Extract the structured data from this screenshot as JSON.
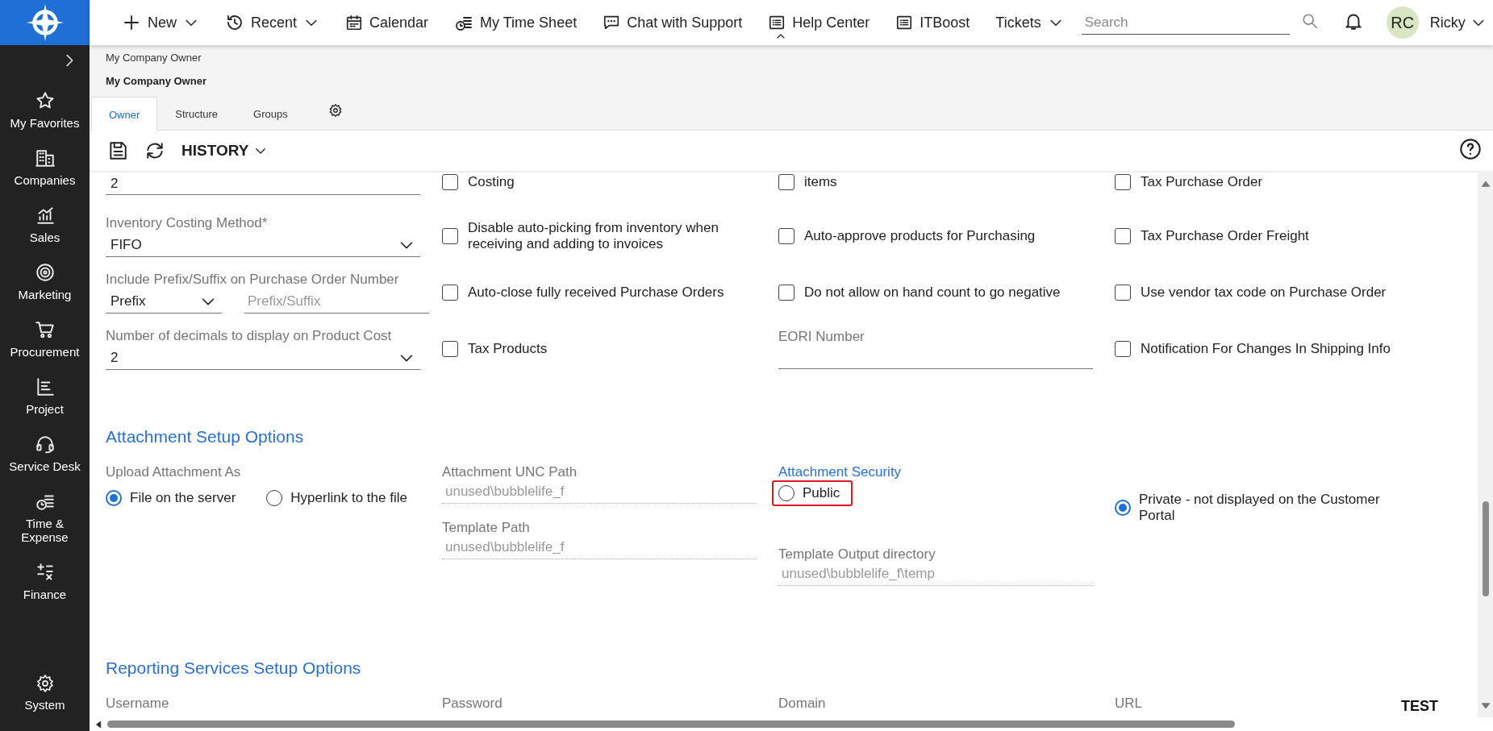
{
  "header": {
    "nav": [
      {
        "label": "New",
        "dropdown": true
      },
      {
        "label": "Recent",
        "dropdown": true
      },
      {
        "label": "Calendar",
        "dropdown": false
      },
      {
        "label": "My Time Sheet",
        "dropdown": false
      },
      {
        "label": "Chat with Support",
        "dropdown": false
      },
      {
        "label": "Help Center",
        "dropdown": false
      },
      {
        "label": "ITBoost",
        "dropdown": false
      },
      {
        "label": "Tickets",
        "dropdown": true
      }
    ],
    "search": {
      "placeholder": "Search"
    },
    "user": {
      "initials": "RC",
      "name": "Ricky"
    }
  },
  "sidebar": {
    "items": [
      {
        "label": "My Favorites"
      },
      {
        "label": "Companies"
      },
      {
        "label": "Sales"
      },
      {
        "label": "Marketing"
      },
      {
        "label": "Procurement"
      },
      {
        "label": "Project"
      },
      {
        "label": "Service Desk"
      },
      {
        "label": "Time & Expense"
      },
      {
        "label": "Finance"
      }
    ],
    "bottom": {
      "label": "System"
    }
  },
  "breadcrumb": "My Company Owner",
  "title": "My Company Owner",
  "tabs": [
    {
      "label": "Owner",
      "selected": true
    },
    {
      "label": "Structure",
      "selected": false
    },
    {
      "label": "Groups",
      "selected": false
    }
  ],
  "toolbar": {
    "history": "HISTORY"
  },
  "rows": [
    [
      {
        "kind": "text",
        "value": "2"
      },
      {
        "kind": "checkbox",
        "label": "Costing",
        "checked": false
      },
      {
        "kind": "checkbox",
        "label": "items",
        "checked": false
      },
      {
        "kind": "checkbox",
        "label": "Tax Purchase Order",
        "checked": false
      }
    ],
    [
      {
        "kind": "select",
        "label": "Inventory Costing Method*",
        "value": "FIFO"
      },
      {
        "kind": "checkbox",
        "label": "Disable auto-picking from inventory when receiving and adding to invoices",
        "checked": false
      },
      {
        "kind": "checkbox",
        "label": "Auto-approve products for Purchasing",
        "checked": false
      },
      {
        "kind": "checkbox",
        "label": "Tax Purchase Order Freight",
        "checked": false
      }
    ],
    [
      {
        "kind": "prefix",
        "label": "Include Prefix/Suffix on Purchase Order Number",
        "value": "Prefix",
        "placeholder": "Prefix/Suffix"
      },
      {
        "kind": "checkbox",
        "label": "Auto-close fully received Purchase Orders",
        "checked": false
      },
      {
        "kind": "checkbox",
        "label": "Do not allow on hand count to go negative",
        "checked": false
      },
      {
        "kind": "checkbox",
        "label": "Use vendor tax code on Purchase Order",
        "checked": false
      }
    ],
    [
      {
        "kind": "select",
        "label": "Number of decimals to display on Product Cost",
        "value": "2"
      },
      {
        "kind": "checkbox",
        "label": "Tax Products",
        "checked": false
      },
      {
        "kind": "text",
        "label": "EORI Number"
      },
      {
        "kind": "checkbox",
        "label": "Notification For Changes In Shipping Info",
        "checked": false
      }
    ]
  ],
  "attachment": {
    "title": "Attachment Setup Options",
    "upload": {
      "label": "Upload Attachment As",
      "options": [
        {
          "label": "File on the server",
          "selected": true
        },
        {
          "label": "Hyperlink to the file",
          "selected": false
        }
      ]
    },
    "unc_path": {
      "label": "Attachment UNC Path",
      "value": "unused\\bubblelife_f"
    },
    "template_path": {
      "label": "Template Path",
      "value": "unused\\bubblelife_f"
    },
    "security": {
      "label": "Attachment Security",
      "options": [
        {
          "label": "Public",
          "selected": false,
          "highlighted": true
        },
        {
          "label": "Private - not displayed on the Customer Portal",
          "selected": true,
          "highlighted": false
        }
      ]
    },
    "template_output": {
      "label": "Template Output directory",
      "value": "unused\\bubblelife_f\\temp"
    }
  },
  "reporting": {
    "title": "Reporting Services Setup Options",
    "fields": [
      "Username",
      "Password",
      "Domain",
      "URL"
    ]
  },
  "environment": "TEST"
}
